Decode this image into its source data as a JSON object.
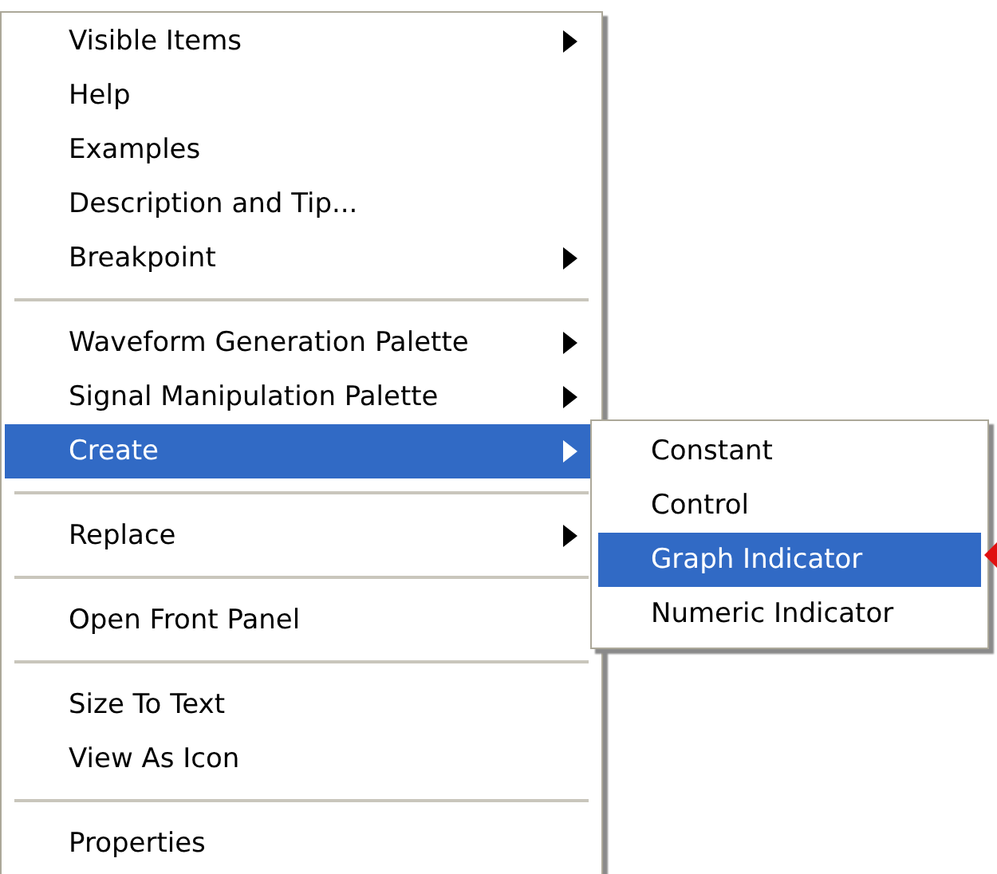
{
  "context_menu": {
    "sections": [
      [
        {
          "label": "Visible Items",
          "submenu": true,
          "selected": false
        },
        {
          "label": "Help",
          "submenu": false,
          "selected": false
        },
        {
          "label": "Examples",
          "submenu": false,
          "selected": false
        },
        {
          "label": "Description and Tip...",
          "submenu": false,
          "selected": false
        },
        {
          "label": "Breakpoint",
          "submenu": true,
          "selected": false
        }
      ],
      [
        {
          "label": "Waveform Generation Palette",
          "submenu": true,
          "selected": false
        },
        {
          "label": "Signal Manipulation Palette",
          "submenu": true,
          "selected": false
        },
        {
          "label": "Create",
          "submenu": true,
          "selected": true
        }
      ],
      [
        {
          "label": "Replace",
          "submenu": true,
          "selected": false
        }
      ],
      [
        {
          "label": "Open Front Panel",
          "submenu": false,
          "selected": false
        }
      ],
      [
        {
          "label": "Size To Text",
          "submenu": false,
          "selected": false
        },
        {
          "label": "View As Icon",
          "submenu": false,
          "selected": false
        }
      ],
      [
        {
          "label": "Properties",
          "submenu": false,
          "selected": false
        }
      ]
    ]
  },
  "submenu": {
    "items": [
      {
        "label": "Constant",
        "selected": false
      },
      {
        "label": "Control",
        "selected": false
      },
      {
        "label": "Graph Indicator",
        "selected": true
      },
      {
        "label": "Numeric Indicator",
        "selected": false
      }
    ]
  },
  "pointer": {
    "kind": "arrow"
  }
}
